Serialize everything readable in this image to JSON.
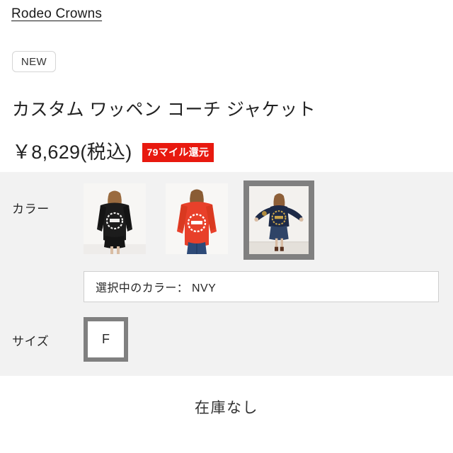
{
  "brand": {
    "name": "Rodeo Crowns"
  },
  "badges": {
    "new_label": "NEW",
    "mile_label": "79マイル還元",
    "mile_color": "#e8190f"
  },
  "product": {
    "title": "カスタム ワッペン コーチ ジャケット",
    "price": "￥8,629(税込)"
  },
  "options": {
    "color": {
      "label": "カラー",
      "selected_text": "選択中のカラー： NVY",
      "selected_index": 2,
      "swatches": [
        {
          "name": "swatch-black-coach-jacket",
          "alt": "BLK",
          "jacket_color": "#1c1c1c",
          "print_color": "#f2f2f2",
          "bottom_color": "#1a1a1a",
          "selected": false
        },
        {
          "name": "swatch-red-coach-jacket",
          "alt": "RED",
          "jacket_color": "#e8402a",
          "print_color": "#ffffff",
          "bottom_color": "#2d4a78",
          "selected": false
        },
        {
          "name": "swatch-navy-coach-jacket",
          "alt": "NVY",
          "jacket_color": "#1d2a47",
          "print_color": "#c8a martin",
          "bottom_color": "#2f4467",
          "selected": true
        }
      ]
    },
    "size": {
      "label": "サイズ",
      "values": [
        {
          "label": "F",
          "selected": true
        }
      ]
    }
  },
  "stock": {
    "status": "在庫なし"
  },
  "colors": {
    "panel_bg": "#f2f2f2",
    "selected_border": "#808080",
    "page_bg": "#ffffff"
  }
}
